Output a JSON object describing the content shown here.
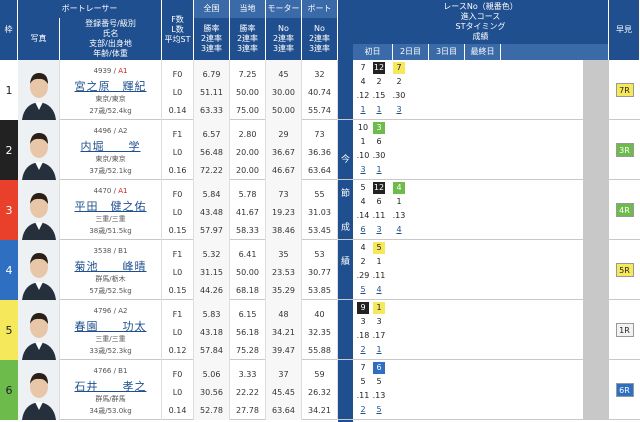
{
  "headers": {
    "waku": "枠",
    "photo": "写真",
    "racer_group": "ボートレーサー",
    "racer_sub": "登録番号/級別\n氏名\n支部/出身地\n年齢/体重",
    "fl": "F数\nL数\n平均ST",
    "national": "全国",
    "national_sub": "勝率\n2連率\n3連率",
    "local": "当地",
    "local_sub": "勝率\n2連率\n3連率",
    "motor": "モーター",
    "motor_sub": "No\n2連率\n3連率",
    "boat": "ボート",
    "boat_sub": "No\n2連率\n3連率",
    "race_info": "レースNo（親番色）\n進入コース\nSTタイミング\n成績",
    "days": [
      "初日",
      "2日目",
      "3日目",
      "最終日"
    ],
    "yoso": "早見",
    "side_text": [
      "今",
      "節",
      "成",
      "績"
    ]
  },
  "racers": [
    {
      "waku": "1",
      "color": "#ffffff",
      "text": "#222",
      "reg": "4939 / ",
      "cls": "A1",
      "name": "宮之原　輝紀",
      "home": "東京/東京",
      "age": "27歳/52.4kg",
      "fl": [
        "F0",
        "L0",
        "0.14"
      ],
      "nat": [
        "6.79",
        "51.11",
        "63.33"
      ],
      "loc": [
        "7.25",
        "50.00",
        "75.00"
      ],
      "mot": [
        "45",
        "30.00",
        "50.00"
      ],
      "boa": [
        "32",
        "40.74",
        "55.74"
      ],
      "sched": {
        "r": [
          "7",
          "12",
          "7"
        ],
        "c": [
          "4",
          "2",
          "2"
        ],
        "st": [
          ".12",
          ".15",
          ".30"
        ],
        "res": [
          "1",
          "1",
          "3"
        ]
      },
      "yoso": "7R",
      "yoso_bg": "#f5e85a"
    },
    {
      "waku": "2",
      "color": "#222222",
      "text": "#fff",
      "reg": "4496 / ",
      "cls": "A2",
      "name": "内堀　　学",
      "home": "東京/東京",
      "age": "37歳/52.1kg",
      "fl": [
        "F1",
        "L0",
        "0.16"
      ],
      "nat": [
        "6.57",
        "56.48",
        "72.22"
      ],
      "loc": [
        "2.80",
        "20.00",
        "20.00"
      ],
      "mot": [
        "29",
        "36.67",
        "46.67"
      ],
      "boa": [
        "73",
        "36.36",
        "63.64"
      ],
      "sched": {
        "r": [
          "10",
          "3"
        ],
        "c": [
          "1",
          "6"
        ],
        "st": [
          ".10",
          ".30"
        ],
        "res": [
          "3",
          "1"
        ]
      },
      "yoso": "3R",
      "yoso_bg": "#6dbb4a"
    },
    {
      "waku": "3",
      "color": "#e8402a",
      "text": "#fff",
      "reg": "4470 / ",
      "cls": "A1",
      "name": "平田　健之佑",
      "home": "三重/三重",
      "age": "38歳/51.5kg",
      "fl": [
        "F0",
        "L0",
        "0.15"
      ],
      "nat": [
        "5.84",
        "43.48",
        "57.97"
      ],
      "loc": [
        "5.78",
        "41.67",
        "58.33"
      ],
      "mot": [
        "73",
        "19.23",
        "38.46"
      ],
      "boa": [
        "55",
        "31.03",
        "53.45"
      ],
      "sched": {
        "r": [
          "5",
          "12",
          "4"
        ],
        "c": [
          "4",
          "6",
          "1"
        ],
        "st": [
          ".14",
          ".11",
          ".13"
        ],
        "res": [
          "6",
          "3",
          "4"
        ]
      },
      "yoso": "4R",
      "yoso_bg": "#6dbb4a"
    },
    {
      "waku": "4",
      "color": "#2f6fc2",
      "text": "#fff",
      "reg": "3538 / ",
      "cls": "B1",
      "name": "菊池　　峰晴",
      "home": "群馬/栃木",
      "age": "57歳/52.5kg",
      "fl": [
        "F1",
        "L0",
        "0.15"
      ],
      "nat": [
        "5.32",
        "31.15",
        "44.26"
      ],
      "loc": [
        "6.41",
        "50.00",
        "68.18"
      ],
      "mot": [
        "35",
        "23.53",
        "35.29"
      ],
      "boa": [
        "53",
        "30.77",
        "53.85"
      ],
      "sched": {
        "r": [
          "4",
          "5"
        ],
        "c": [
          "2",
          "1"
        ],
        "st": [
          ".29",
          ".11"
        ],
        "res": [
          "5",
          "4"
        ]
      },
      "yoso": "5R",
      "yoso_bg": "#f5e85a"
    },
    {
      "waku": "5",
      "color": "#f5e85a",
      "text": "#222",
      "reg": "4796 / ",
      "cls": "A2",
      "name": "春園　　功太",
      "home": "三重/三重",
      "age": "33歳/52.3kg",
      "fl": [
        "F1",
        "L0",
        "0.12"
      ],
      "nat": [
        "5.83",
        "43.18",
        "57.84"
      ],
      "loc": [
        "6.15",
        "56.18",
        "75.28"
      ],
      "mot": [
        "48",
        "34.21",
        "39.47"
      ],
      "boa": [
        "40",
        "32.35",
        "55.88"
      ],
      "sched": {
        "r": [
          "9",
          "1"
        ],
        "c": [
          "3",
          "3"
        ],
        "st": [
          ".18",
          ".17"
        ],
        "res": [
          "2",
          "1"
        ]
      },
      "yoso": "1R",
      "yoso_bg": "#f2f2f2"
    },
    {
      "waku": "6",
      "color": "#6dbb4a",
      "text": "#222",
      "reg": "4766 / ",
      "cls": "B1",
      "name": "石井　　孝之",
      "home": "群馬/群馬",
      "age": "34歳/53.0kg",
      "fl": [
        "F0",
        "L0",
        "0.14"
      ],
      "nat": [
        "5.06",
        "30.56",
        "52.78"
      ],
      "loc": [
        "3.33",
        "22.22",
        "27.78"
      ],
      "mot": [
        "37",
        "45.45",
        "63.64"
      ],
      "boa": [
        "59",
        "26.32",
        "34.21"
      ],
      "sched": {
        "r": [
          "7",
          "6"
        ],
        "c": [
          "5",
          "5"
        ],
        "st": [
          ".11",
          ".13"
        ],
        "res": [
          "2",
          "5"
        ]
      },
      "yoso": "6R",
      "yoso_bg": "#2f6fc2"
    }
  ]
}
